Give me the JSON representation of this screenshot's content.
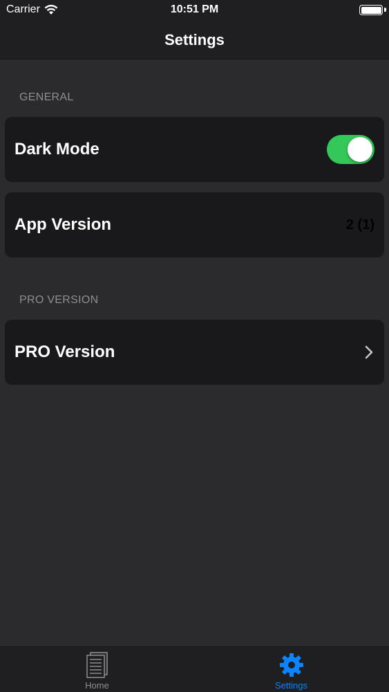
{
  "status_bar": {
    "carrier": "Carrier",
    "time": "10:51 PM"
  },
  "nav": {
    "title": "Settings"
  },
  "sections": {
    "general": {
      "header": "GENERAL",
      "dark_mode_label": "Dark Mode",
      "dark_mode_on": true,
      "app_version_label": "App Version",
      "app_version_value": "2 (1)"
    },
    "pro": {
      "header": "PRO VERSION",
      "pro_version_label": "PRO Version"
    }
  },
  "tabs": {
    "home_label": "Home",
    "settings_label": "Settings"
  },
  "colors": {
    "toggle_on": "#34c759",
    "tab_active": "#0a84ff",
    "tab_inactive": "#8e8e93"
  },
  "icons": {
    "wifi": "wifi-icon",
    "battery": "battery-icon",
    "chevron": "chevron-right-icon",
    "home": "document-icon",
    "settings": "gear-icon"
  }
}
